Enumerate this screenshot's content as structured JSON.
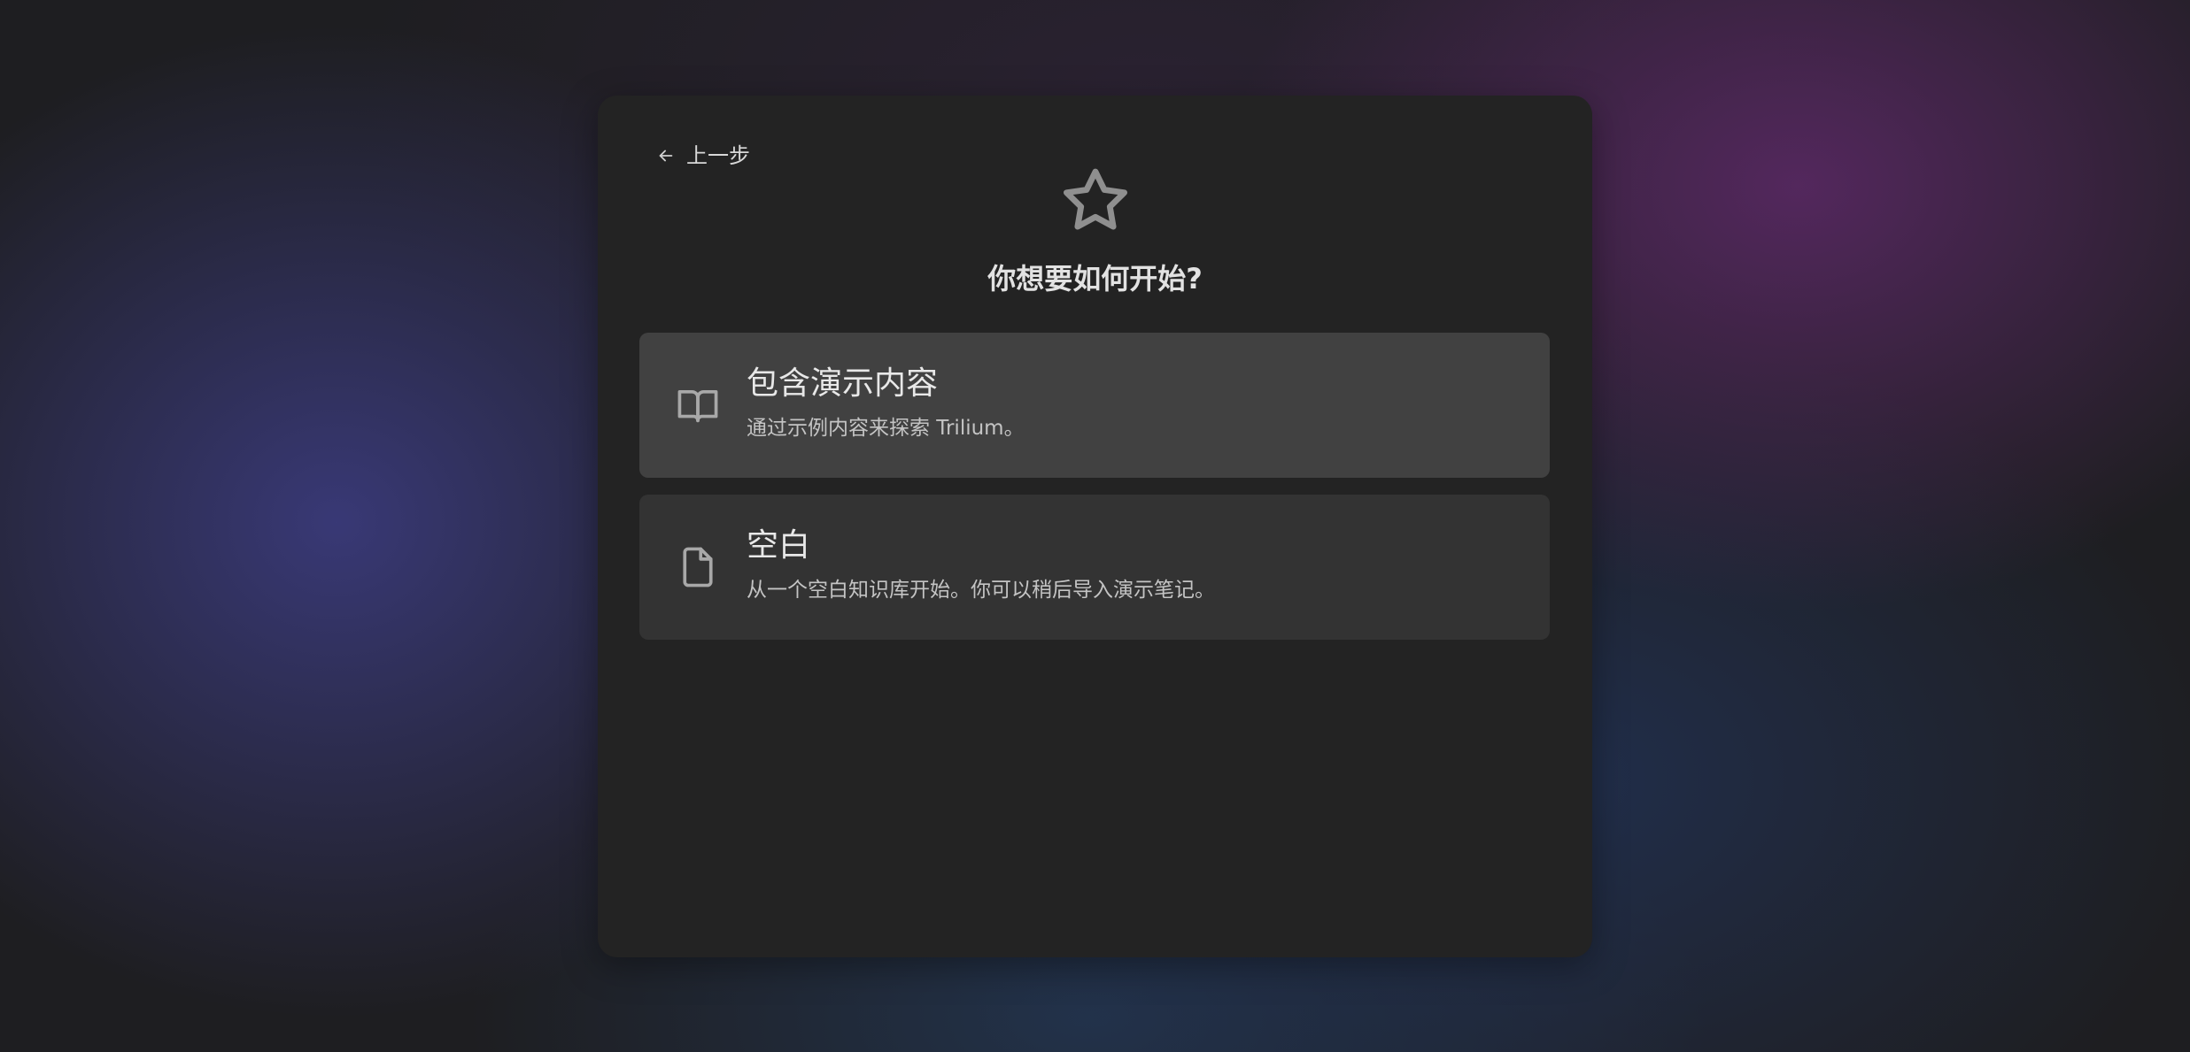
{
  "header": {
    "back_label": "上一步",
    "title": "你想要如何开始?"
  },
  "options": [
    {
      "title": "包含演示内容",
      "description": "通过示例内容来探索 Trilium。",
      "icon": "book-open-icon"
    },
    {
      "title": "空白",
      "description": "从一个空白知识库开始。你可以稍后导入演示笔记。",
      "icon": "file-icon"
    }
  ],
  "icons": {
    "hero": "star-icon",
    "back": "arrow-left-icon"
  },
  "colors": {
    "card_background": "#232323",
    "option_highlight": "#414141",
    "option_background": "#333333",
    "icon": "#8f8f8f"
  }
}
